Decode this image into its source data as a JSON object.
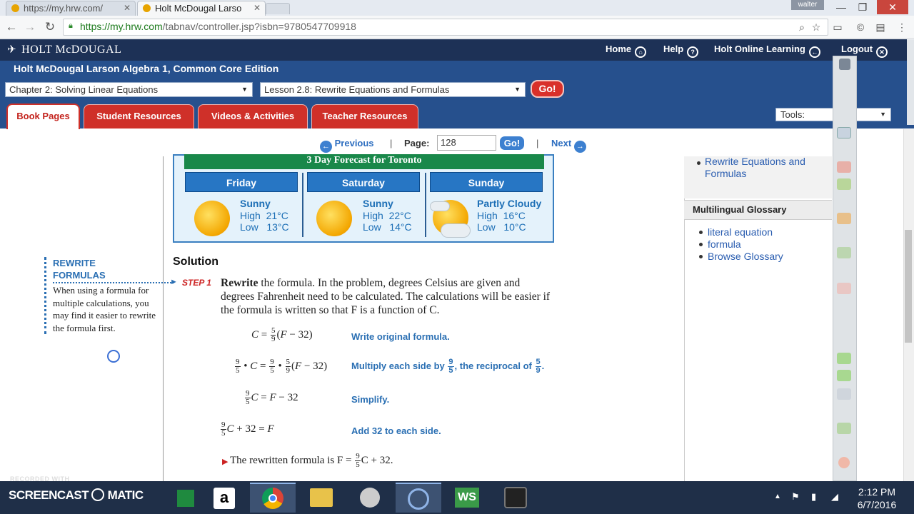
{
  "browser": {
    "tabs": [
      {
        "title": "https://my.hrw.com/"
      },
      {
        "title": "Holt McDougal Larso"
      }
    ],
    "user": "walter",
    "url_host": "https://my.hrw.com",
    "url_path": "/tabnav/controller.jsp?isbn=9780547709918"
  },
  "site": {
    "logo": "HOLT McDOUGAL",
    "nav": {
      "home": "Home",
      "help": "Help",
      "online": "Holt Online Learning",
      "logout": "Logout"
    },
    "book_title": "Holt McDougal Larson Algebra 1, Common Core Edition",
    "chapter_select": "Chapter 2: Solving Linear Equations",
    "lesson_select": "Lesson 2.8: Rewrite Equations and Formulas",
    "go_label": "Go!",
    "tabs": {
      "book": "Book Pages",
      "student": "Student Resources",
      "videos": "Videos & Activities",
      "teacher": "Teacher Resources"
    },
    "tools_label": "Tools:"
  },
  "pager": {
    "previous": "Previous",
    "page_label": "Page:",
    "page_value": "128",
    "go": "Go!",
    "next": "Next",
    "sep": "|"
  },
  "forecast": {
    "title": "3 Day Forecast for Toronto",
    "days": [
      {
        "day": "Friday",
        "cond": "Sunny",
        "high": "High  21°C",
        "low": "Low   13°C"
      },
      {
        "day": "Saturday",
        "cond": "Sunny",
        "high": "High  22°C",
        "low": "Low   14°C"
      },
      {
        "day": "Sunday",
        "cond": "Partly Cloudy",
        "high": "High  16°C",
        "low": "Low   10°C"
      }
    ]
  },
  "textbook": {
    "solution": "Solution",
    "note_title_1": "REWRITE",
    "note_title_2": "FORMULAS",
    "note_body": "When using a formula for multiple calculations, you may find it easier to rewrite the formula first.",
    "step_label": "STEP 1",
    "step_bold": "Rewrite",
    "step_text": " the formula. In the problem, degrees Celsius are given and degrees Fahrenheit need to be calculated. The calculations will be easier if the formula is written so that F is a function of C.",
    "reasons": [
      "Write original formula.",
      "Multiply each side by",
      "Simplify.",
      "Add 32 to each side."
    ],
    "reason2_mid": ", the reciprocal of",
    "result": "The rewritten formula is F = ",
    "result_tail": "C + 32."
  },
  "right_panel": {
    "lesson_link": "Rewrite Equations and Formulas",
    "glossary_title": "Multilingual Glossary",
    "glossary_links": [
      "literal equation",
      "formula",
      "Browse Glossary"
    ]
  },
  "taskbar": {
    "recorded": "RECORDED WITH",
    "brand": "SCREENCAST",
    "brand2": "MATIC",
    "time": "2:12 PM",
    "date": "6/7/2016"
  },
  "colors": {
    "site_navy": "#1d3156",
    "site_blue": "#26508d",
    "tab_red": "#cf3029",
    "link_blue": "#2a5db0"
  }
}
